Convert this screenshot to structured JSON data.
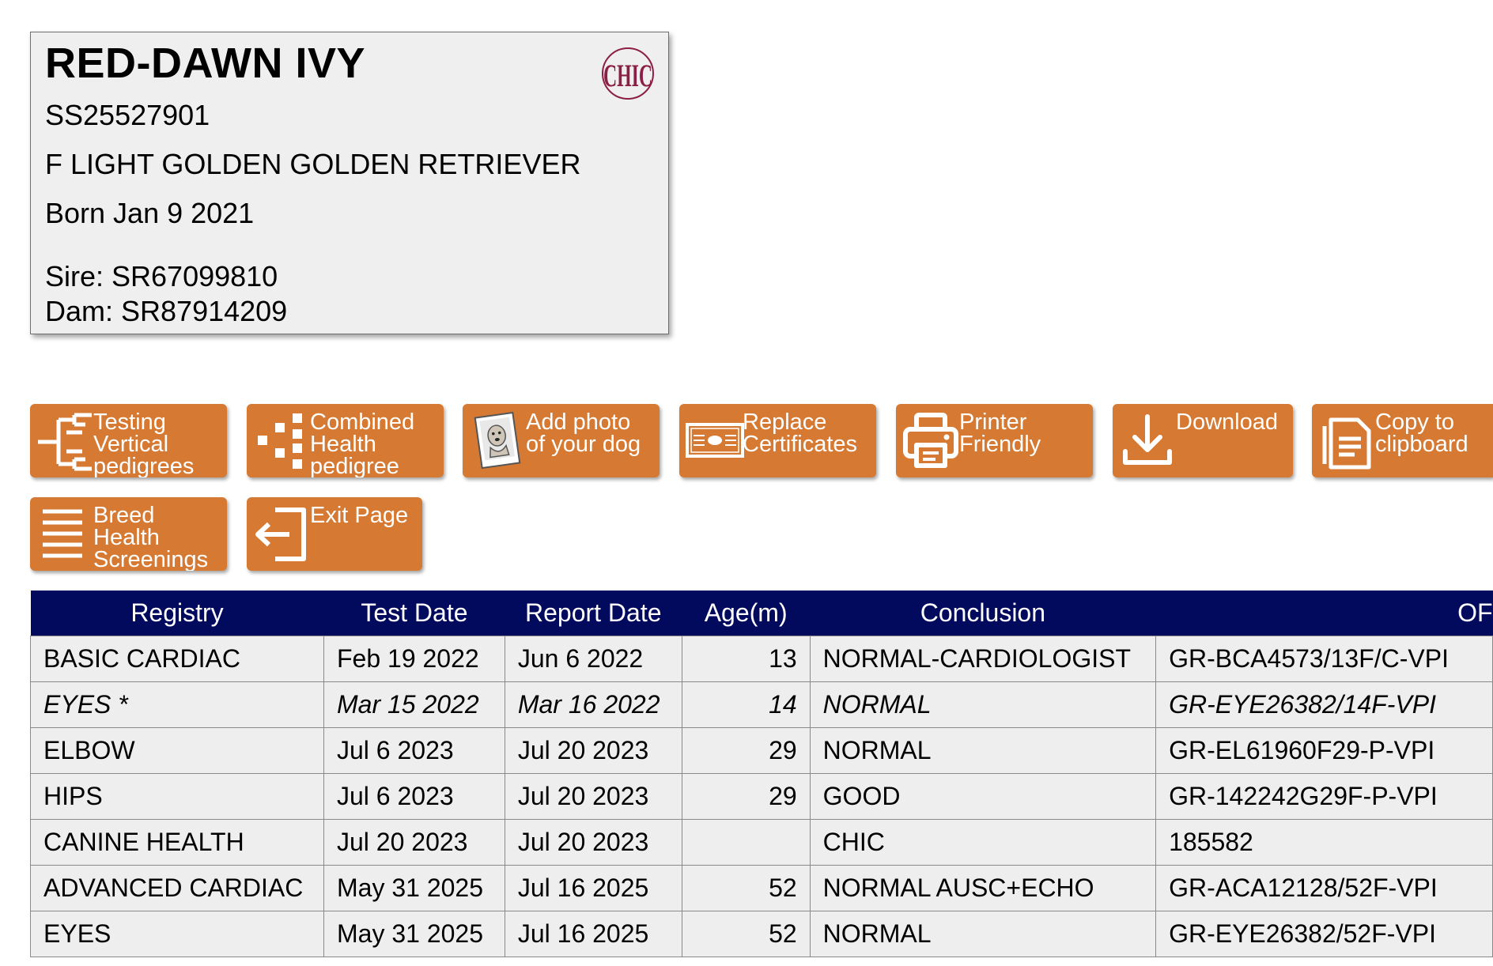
{
  "dog": {
    "name": "RED-DAWN IVY",
    "registration": "SS25527901",
    "description": "F LIGHT GOLDEN GOLDEN RETRIEVER",
    "born": "Born Jan 9 2021",
    "sire": "Sire: SR67099810",
    "dam": "Dam: SR87914209",
    "logo_text": "CHIC"
  },
  "colors": {
    "button_orange": "#d67a33",
    "header_navy": "#020a5e",
    "chic_maroon": "#8c1f45"
  },
  "buttons": [
    {
      "label": "Testing\nVertical\npedigrees",
      "icon": "vertical-pedigree-icon"
    },
    {
      "label": "Combined\nHealth\npedigree",
      "icon": "combined-pedigree-icon"
    },
    {
      "label": "Add photo\nof your dog",
      "icon": "dog-photo-icon"
    },
    {
      "label": "Replace\nCertificates",
      "icon": "certificate-icon"
    },
    {
      "label": "Printer\nFriendly",
      "icon": "printer-icon"
    },
    {
      "label": "Download",
      "icon": "download-icon"
    },
    {
      "label": "Copy to\nclipboard",
      "icon": "clipboard-icon"
    },
    {
      "label": "Breed\nHealth\nScreenings",
      "icon": "list-icon"
    },
    {
      "label": "Exit Page",
      "icon": "exit-icon"
    }
  ],
  "table": {
    "headers": [
      "Registry",
      "Test Date",
      "Report Date",
      "Age(m)",
      "Conclusion",
      "OF"
    ],
    "rows": [
      {
        "registry": "BASIC CARDIAC",
        "test_date": "Feb 19 2022",
        "report_date": "Jun 6 2022",
        "age": "13",
        "conclusion": "NORMAL-CARDIOLOGIST",
        "ofa": "GR-BCA4573/13F/C-VPI",
        "italic": false
      },
      {
        "registry": "EYES *",
        "test_date": "Mar 15 2022",
        "report_date": "Mar 16 2022",
        "age": "14",
        "conclusion": "NORMAL",
        "ofa": "GR-EYE26382/14F-VPI",
        "italic": true
      },
      {
        "registry": "ELBOW",
        "test_date": "Jul 6 2023",
        "report_date": "Jul 20 2023",
        "age": "29",
        "conclusion": "NORMAL",
        "ofa": "GR-EL61960F29-P-VPI",
        "italic": false
      },
      {
        "registry": "HIPS",
        "test_date": "Jul 6 2023",
        "report_date": "Jul 20 2023",
        "age": "29",
        "conclusion": "GOOD",
        "ofa": "GR-142242G29F-P-VPI",
        "italic": false
      },
      {
        "registry": "CANINE HEALTH",
        "test_date": "Jul 20 2023",
        "report_date": "Jul 20 2023",
        "age": "",
        "conclusion": "CHIC",
        "ofa": "185582",
        "italic": false
      },
      {
        "registry": "ADVANCED CARDIAC",
        "test_date": "May 31 2025",
        "report_date": "Jul 16 2025",
        "age": "52",
        "conclusion": "NORMAL AUSC+ECHO",
        "ofa": "GR-ACA12128/52F-VPI",
        "italic": false
      },
      {
        "registry": "EYES",
        "test_date": "May 31 2025",
        "report_date": "Jul 16 2025",
        "age": "52",
        "conclusion": "NORMAL",
        "ofa": "GR-EYE26382/52F-VPI",
        "italic": false
      }
    ]
  }
}
